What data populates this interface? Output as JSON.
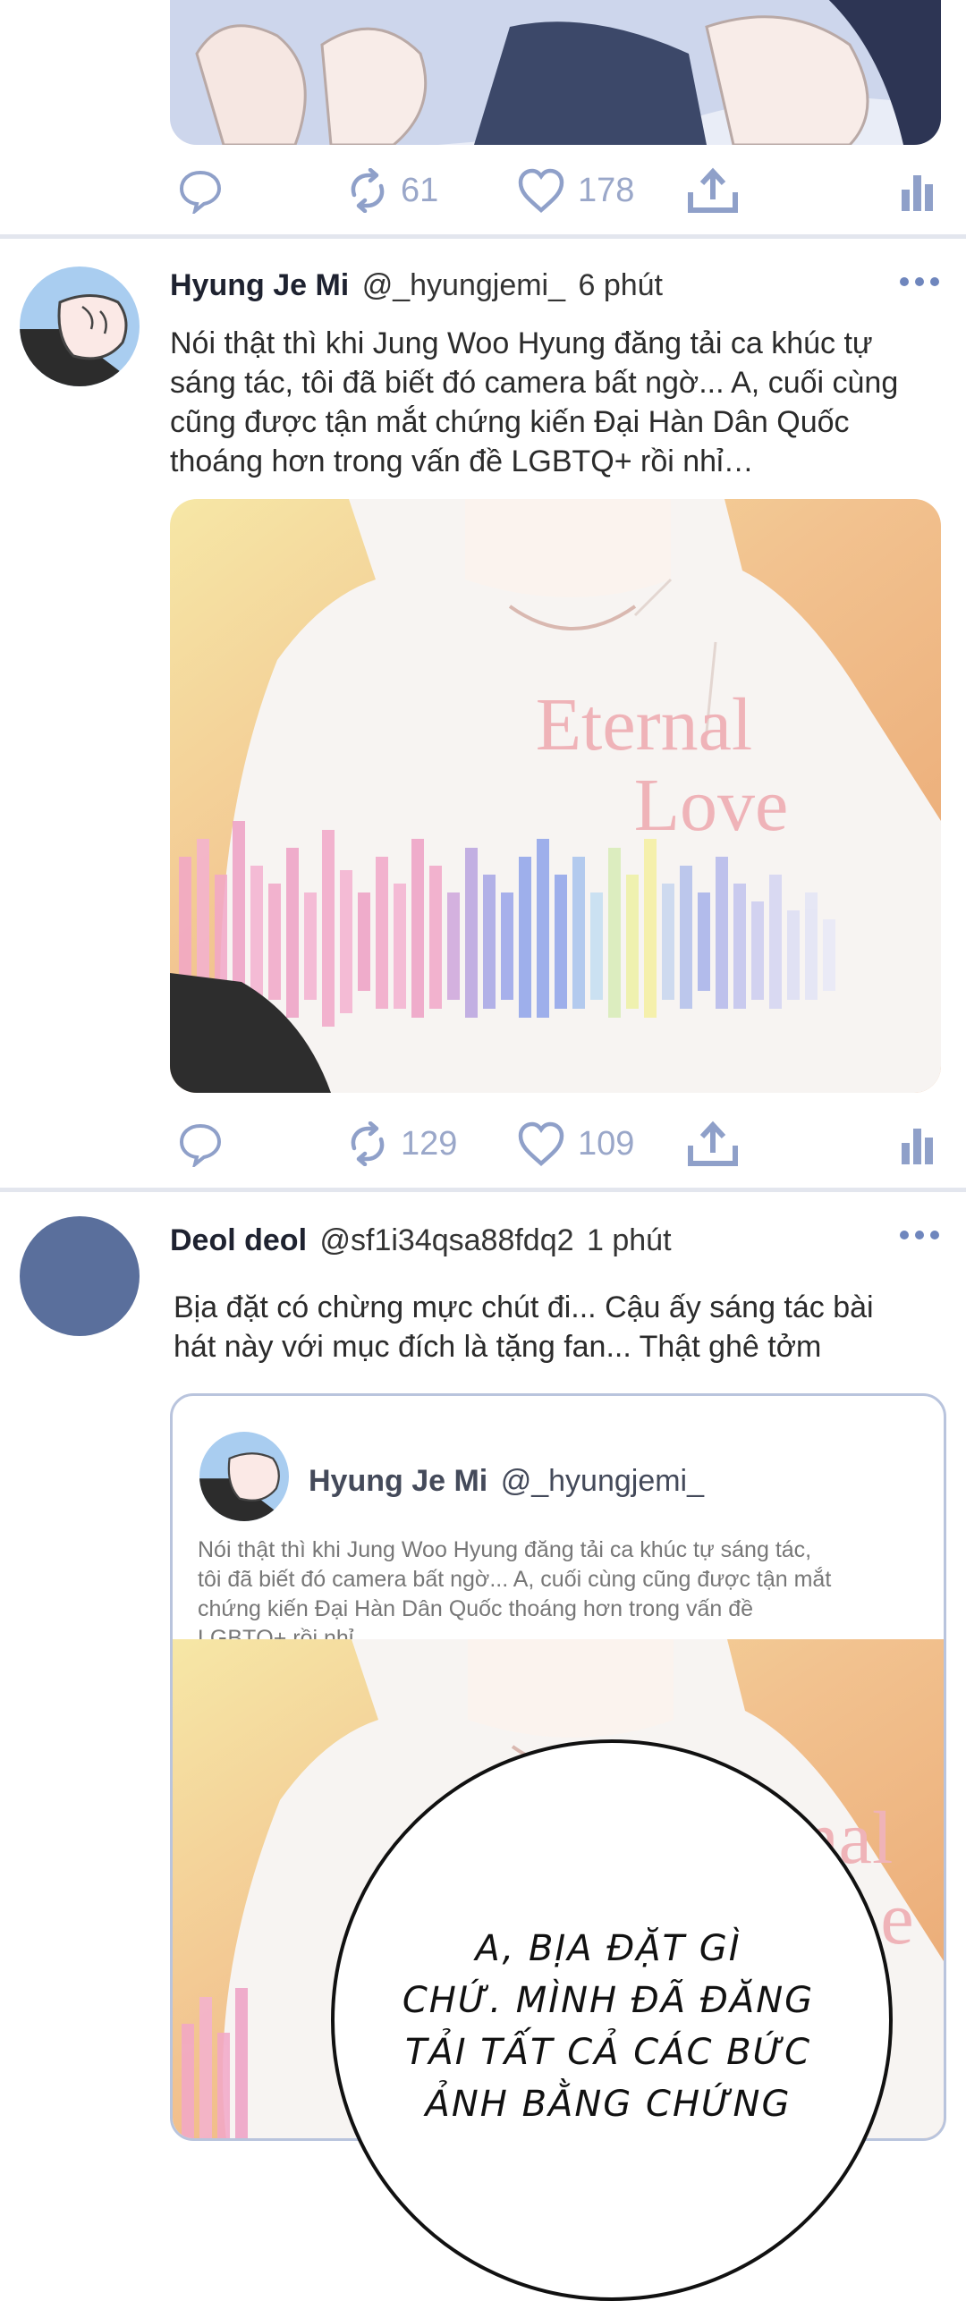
{
  "colors": {
    "accent": "#6f86bd",
    "icon": "#8fa0c9",
    "divider": "#e3e6ee",
    "avatar_blue": "#5a6f9c"
  },
  "tweet0": {
    "stats": {
      "retweets": "61",
      "likes": "178"
    }
  },
  "tweet1": {
    "name": "Hyung Je Mi",
    "handle": "@_hyungjemi_",
    "time": "6 phút",
    "text_lines": [
      "Nói thật thì khi Jung Woo Hyung đăng tải ca khúc tự",
      "sáng tác, tôi đã biết đó camera bất ngờ... A, cuối cùng",
      "cũng được tận mắt chứng kiến Đại Hàn Dân Quốc",
      "thoáng hơn trong vấn đề LGBTQ+ rồi nhỉ…"
    ],
    "image_overlay": {
      "line1": "Eternal",
      "line2": "Love"
    },
    "stats": {
      "retweets": "129",
      "likes": "109"
    }
  },
  "tweet2": {
    "name": "Deol deol",
    "handle": "@sf1i34qsa88fdq2",
    "time": "1 phút",
    "text_lines": [
      "Bịa đặt có chừng mực chút đi... Cậu ấy sáng tác bài",
      "hát này với mục đích là tặng fan... Thật ghê tởm"
    ],
    "quote": {
      "name": "Hyung Je Mi",
      "handle": "@_hyungjemi_",
      "text_lines": [
        "Nói thật thì khi Jung Woo Hyung đăng tải ca khúc tự sáng tác,",
        "tôi đã biết đó camera bất ngờ... A, cuối cùng cũng được tận mắt",
        "chứng kiến Đại Hàn Dân Quốc thoáng hơn trong vấn đề",
        "LGBTQ+ rồi nhỉ…"
      ],
      "image_overlay": {
        "line1": "rnal",
        "line2": "e"
      }
    }
  },
  "speech_bubble": {
    "lines": [
      "A, BỊA ĐẶT GÌ",
      "CHỨ. MÌNH ĐÃ ĐĂNG",
      "TẢI TẤT CẢ CÁC BỨC",
      "ẢNH BẰNG CHỨNG"
    ]
  },
  "icons": [
    "reply-icon",
    "retweet-icon",
    "like-icon",
    "share-icon",
    "analytics-icon",
    "more-icon"
  ]
}
